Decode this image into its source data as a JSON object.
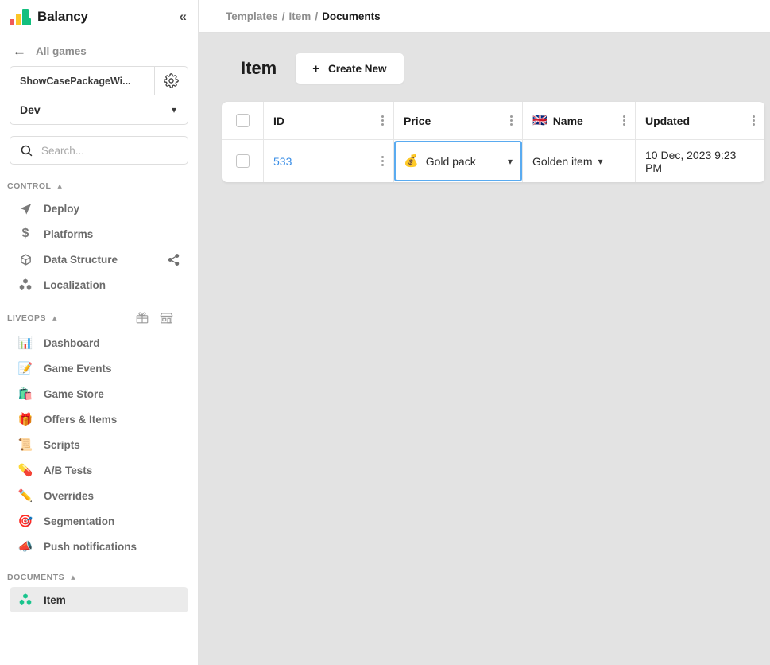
{
  "sidebar": {
    "brand": {
      "name": "Balancy",
      "logo_icon": "bar-chart-logo",
      "collapse_icon": "chevron-double-left"
    },
    "back": {
      "label": "All games",
      "icon": "arrow-left-icon"
    },
    "project": {
      "name": "ShowCasePackageWi...",
      "gear_icon": "gear-icon"
    },
    "environment": {
      "value": "Dev",
      "chevron_icon": "chevron-down-icon"
    },
    "search": {
      "placeholder": "Search...",
      "value": "",
      "icon": "search-icon"
    },
    "sections": [
      {
        "title": "CONTROL",
        "caret_icon": "chevron-up-icon",
        "header_icons": [],
        "items": [
          {
            "label": "Deploy",
            "icon": "paper-plane-icon",
            "active": false,
            "right_icon": ""
          },
          {
            "label": "Platforms",
            "icon": "dollar-icon",
            "active": false,
            "right_icon": ""
          },
          {
            "label": "Data Structure",
            "icon": "cube-icon",
            "active": false,
            "right_icon": "share-icon"
          },
          {
            "label": "Localization",
            "icon": "cubes-icon",
            "active": false,
            "right_icon": ""
          }
        ]
      },
      {
        "title": "LIVEOPS",
        "caret_icon": "chevron-up-icon",
        "header_icons": [
          "gift-icon",
          "store-icon"
        ],
        "items": [
          {
            "label": "Dashboard",
            "icon": "📊",
            "active": false,
            "right_icon": ""
          },
          {
            "label": "Game Events",
            "icon": "📝",
            "active": false,
            "right_icon": ""
          },
          {
            "label": "Game Store",
            "icon": "🛍️",
            "active": false,
            "right_icon": ""
          },
          {
            "label": "Offers & Items",
            "icon": "🎁",
            "active": false,
            "right_icon": ""
          },
          {
            "label": "Scripts",
            "icon": "📜",
            "active": false,
            "right_icon": ""
          },
          {
            "label": "A/B Tests",
            "icon": "💊",
            "active": false,
            "right_icon": ""
          },
          {
            "label": "Overrides",
            "icon": "✏️",
            "active": false,
            "right_icon": ""
          },
          {
            "label": "Segmentation",
            "icon": "🎯",
            "active": false,
            "right_icon": ""
          },
          {
            "label": "Push notifications",
            "icon": "📣",
            "active": false,
            "right_icon": ""
          }
        ]
      },
      {
        "title": "DOCUMENTS",
        "caret_icon": "chevron-up-icon",
        "header_icons": [],
        "items": [
          {
            "label": "Item",
            "icon": "green-cubes-icon",
            "active": true,
            "right_icon": ""
          }
        ]
      }
    ]
  },
  "breadcrumb": {
    "items": [
      "Templates",
      "Item",
      "Documents"
    ],
    "separator": "/"
  },
  "page": {
    "title": "Item",
    "create_button": {
      "label": "Create New",
      "plus": "+"
    }
  },
  "table": {
    "columns": [
      {
        "key": "check",
        "label": "",
        "icon": "",
        "kebab": false
      },
      {
        "key": "id",
        "label": "ID",
        "icon": "",
        "kebab": true
      },
      {
        "key": "price",
        "label": "Price",
        "icon": "",
        "kebab": true
      },
      {
        "key": "name",
        "label": "Name",
        "icon": "🇬🇧",
        "kebab": true
      },
      {
        "key": "updated",
        "label": "Updated",
        "icon": "",
        "kebab": true
      }
    ],
    "rows": [
      {
        "id": "533",
        "price": {
          "icon": "💰",
          "label": "Gold pack",
          "selected": true,
          "chevron": "⌄"
        },
        "name": {
          "label": "Golden item",
          "chevron": "⌄"
        },
        "updated": "10 Dec, 2023 9:23 PM"
      }
    ]
  },
  "colors": {
    "accent_blue": "#3a8ee6",
    "selection_border": "#5aabf0",
    "page_bg": "#e3e3e3",
    "active_nav_bg": "#ebebeb",
    "logo_red": "#f05a5a",
    "logo_yellow": "#fcc627",
    "logo_green": "#13bf7e"
  }
}
